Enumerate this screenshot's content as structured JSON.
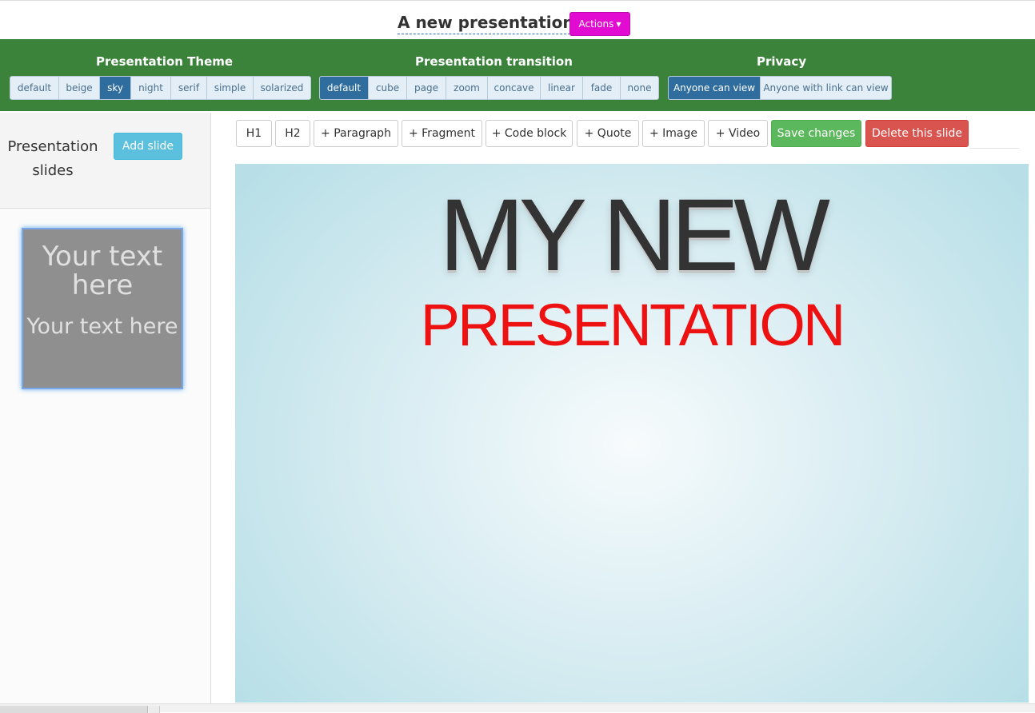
{
  "header": {
    "title": "A new presentation",
    "actions_label": "Actions",
    "actions_color": "#e20bd1"
  },
  "settings": {
    "background_color": "#3b833b",
    "theme": {
      "title": "Presentation Theme",
      "options": [
        "default",
        "beige",
        "sky",
        "night",
        "serif",
        "simple",
        "solarized"
      ],
      "selected": "sky"
    },
    "transition": {
      "title": "Presentation transition",
      "options": [
        "default",
        "cube",
        "page",
        "zoom",
        "concave",
        "linear",
        "fade",
        "none"
      ],
      "selected": "default"
    },
    "privacy": {
      "title": "Privacy",
      "options": [
        "Anyone can view",
        "Anyone with link can view"
      ],
      "selected": "Anyone can view"
    }
  },
  "sidebar": {
    "title": "Presentation slides",
    "add_slide_label": "Add slide",
    "slides": [
      {
        "heading": "Your text here",
        "paragraph": "Your text here"
      }
    ]
  },
  "toolbar": {
    "h1": "H1",
    "h2": "H2",
    "paragraph": "+ Paragraph",
    "fragment": "+ Fragment",
    "code_block": "+ Code block",
    "quote": "+ Quote",
    "image": "+ Image",
    "video": "+ Video",
    "save": "Save changes",
    "delete": "Delete this slide"
  },
  "slide": {
    "h1": "MY NEW",
    "h2": "PRESENTATION",
    "h2_color": "#ee1111"
  }
}
